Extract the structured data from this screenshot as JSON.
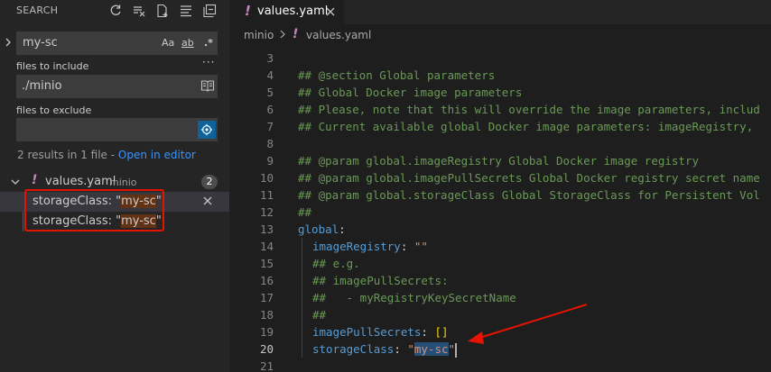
{
  "sidebar": {
    "title": "SEARCH",
    "search_value": "my-sc",
    "option_case": "Aa",
    "option_word": "ab",
    "option_regex": ".*",
    "more": "···",
    "include_label": "files to include",
    "include_value": "./minio",
    "exclude_label": "files to exclude",
    "exclude_value": "",
    "summary": "2 results in 1 file - ",
    "open_in_editor": "Open in editor",
    "file": {
      "icon": "!",
      "name": "values.yaml",
      "dir": "minio",
      "count": "2"
    },
    "matches": [
      {
        "before": "storageClass: \"",
        "match": "my-sc",
        "after": "\""
      },
      {
        "before": "storageClass: \"",
        "match": "my-sc",
        "after": "\""
      }
    ]
  },
  "tab": {
    "icon": "!",
    "name": "values.yaml"
  },
  "breadcrumb": {
    "dir": "minio",
    "icon": "!",
    "file": "values.yaml"
  },
  "code": [
    {
      "n": "3",
      "t": ""
    },
    {
      "n": "4",
      "t": "## @section Global parameters"
    },
    {
      "n": "5",
      "t": "## Global Docker image parameters"
    },
    {
      "n": "6",
      "t": "## Please, note that this will override the image parameters, includ"
    },
    {
      "n": "7",
      "t": "## Current available global Docker image parameters: imageRegistry, "
    },
    {
      "n": "8",
      "t": ""
    },
    {
      "n": "9",
      "t": "## @param global.imageRegistry Global Docker image registry"
    },
    {
      "n": "10",
      "t": "## @param global.imagePullSecrets Global Docker registry secret name"
    },
    {
      "n": "11",
      "t": "## @param global.storageClass Global StorageClass for Persistent Vol"
    },
    {
      "n": "12",
      "t": "##"
    },
    {
      "n": "13",
      "k": "global",
      "p": ":"
    },
    {
      "n": "14",
      "k": "imageRegistry",
      "p": ": ",
      "s": "\"\""
    },
    {
      "n": "15",
      "t": "## e.g."
    },
    {
      "n": "16",
      "t": "## imagePullSecrets:"
    },
    {
      "n": "17",
      "t": "##   - myRegistryKeySecretName"
    },
    {
      "n": "18",
      "t": "##"
    },
    {
      "n": "19",
      "k": "imagePullSecrets",
      "p": ": ",
      "b": "[]"
    },
    {
      "n": "20",
      "k": "storageClass",
      "p": ": ",
      "q1": "\"",
      "m": "my-sc",
      "q2": "\""
    },
    {
      "n": "21",
      "t": ""
    }
  ],
  "colors": {
    "accent": "#0e639c",
    "annotation": "#e51400",
    "comment": "#6a9955",
    "key": "#569cd6",
    "string": "#ce9178"
  }
}
